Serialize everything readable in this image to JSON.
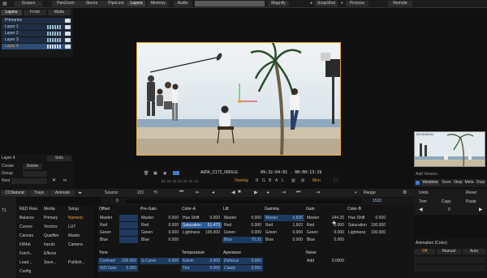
{
  "top_menu": [
    "Scopes",
    "PanZoom",
    "Stereo",
    "PipeLine",
    "Layers",
    "Memory",
    "Audio",
    "Magnify",
    "SnapShot",
    "Process",
    "Remote"
  ],
  "top_menu_selected": "Layers",
  "layers_tabs": [
    "Layers",
    "Front",
    "Matte"
  ],
  "layers": [
    "Primaries",
    "Layer 1",
    "Layer 2",
    "Layer 3",
    "Layer 4"
  ],
  "selected_layer": "Layer 4",
  "layer_panel": {
    "name": "Layer 4",
    "solo": "Solo",
    "create": "Create",
    "delete": "Delete",
    "group": "Group",
    "nest": "Nest"
  },
  "transport": {
    "clip_name": "A004_C172_0901LE",
    "timecode": "09:32:04:01 - 00:00:13:19",
    "overlay": "Overlay",
    "channels": [
      "R",
      "G",
      "B",
      "A",
      "L"
    ],
    "mon": "Mon"
  },
  "source_row": {
    "source_label": "Source:",
    "source_value": "221",
    "range_label": "Range",
    "range_value": "1533",
    "frame_value": "0"
  },
  "versions": {
    "snapshot_time": "09:23:45:01",
    "add_version": "Add Version",
    "tabs": [
      "Versions",
      "Snsn",
      "Stwp",
      "Meta",
      "Outp"
    ],
    "undo": "Undo",
    "reset": "Reset",
    "trim": "Trim",
    "copy": "Copy",
    "paste": "Paste",
    "step_value": "0"
  },
  "tool_tabs": [
    "CCNatural",
    "Trays",
    "Animate"
  ],
  "sidebar_num": "T1",
  "tools": [
    [
      "RED Raw",
      "Media",
      "Setup"
    ],
    [
      "Balance",
      "Primary",
      "Numeric"
    ],
    [
      "Curves",
      "Vectors",
      "LUT"
    ],
    [
      "Canvas",
      "Qualifier",
      "Masks"
    ],
    [
      "FilMat",
      "Inputs",
      "Camera"
    ],
    [
      "Fetch...",
      "Effects",
      ""
    ],
    [
      "Load...",
      "Save...",
      "Publish..."
    ],
    [
      "Config",
      "",
      ""
    ]
  ],
  "selected_tool": "Numeric",
  "groups": {
    "offset": {
      "title": "Offset",
      "rows": [
        [
          "Master",
          ""
        ],
        [
          "Red",
          ""
        ],
        [
          "Green",
          ""
        ],
        [
          "Blue",
          ""
        ]
      ]
    },
    "pregain": {
      "title": "Pre-Gain",
      "rows": [
        [
          "Master",
          "0.000"
        ],
        [
          "Red",
          "0.000"
        ],
        [
          "Green",
          "0.000"
        ],
        [
          "Blue",
          "0.000"
        ]
      ]
    },
    "colora": {
      "title": "Color-A",
      "rows": [
        [
          "Hue Shift",
          "0.000"
        ],
        [
          "Saturation",
          "61.473"
        ],
        [
          "Lightness",
          "100.000"
        ]
      ]
    },
    "lift": {
      "title": "Lift",
      "rows": [
        [
          "Master",
          "0.000"
        ],
        [
          "Red",
          "0.000"
        ],
        [
          "Green",
          "0.000"
        ],
        [
          "Blue",
          "70.31"
        ]
      ]
    },
    "gamma": {
      "title": "Gamma",
      "rows": [
        [
          "Master",
          "0.836"
        ],
        [
          "Red",
          "1.663"
        ],
        [
          "Green",
          "0.000"
        ],
        [
          "Blue",
          "0.000"
        ]
      ]
    },
    "gain": {
      "title": "Gain",
      "rows": [
        [
          "Master",
          "244.25"
        ],
        [
          "Red",
          "0.000"
        ],
        [
          "Green",
          "0.000"
        ],
        [
          "Blue",
          "0.000"
        ]
      ]
    },
    "colorb": {
      "title": "Color-B",
      "rows": [
        [
          "Hue Shift",
          "0.000"
        ],
        [
          "Saturation",
          "100.000"
        ],
        [
          "Lightness",
          "100.000"
        ]
      ]
    },
    "tone": {
      "title": "Tone",
      "rows": [
        [
          "Contrast",
          "100.000"
        ],
        [
          "ISO Gain",
          "0.000"
        ]
      ]
    },
    "scurve": {
      "rows": [
        [
          "S-Curve",
          "0.000"
        ]
      ]
    },
    "temperature": {
      "title": "Temperature",
      "rows": [
        [
          "Kelvin",
          "0.000"
        ],
        [
          "Tint",
          "0.000"
        ]
      ]
    },
    "aperature": {
      "title": "Aperature",
      "rows": [
        [
          "Defocus",
          "0.000"
        ],
        [
          "Clarity",
          "0.000"
        ]
      ]
    },
    "noise": {
      "title": "Noise",
      "rows": [
        [
          "Add",
          "0.0000"
        ]
      ]
    }
  },
  "animation": {
    "title": "Animation (Color)",
    "off": "Off",
    "manual": "Manual",
    "auto": "Auto"
  },
  "colors": {
    "accent": "#e8a33a",
    "selected_blue": "#2a5b94",
    "field_blue": "#1d3a5f"
  }
}
